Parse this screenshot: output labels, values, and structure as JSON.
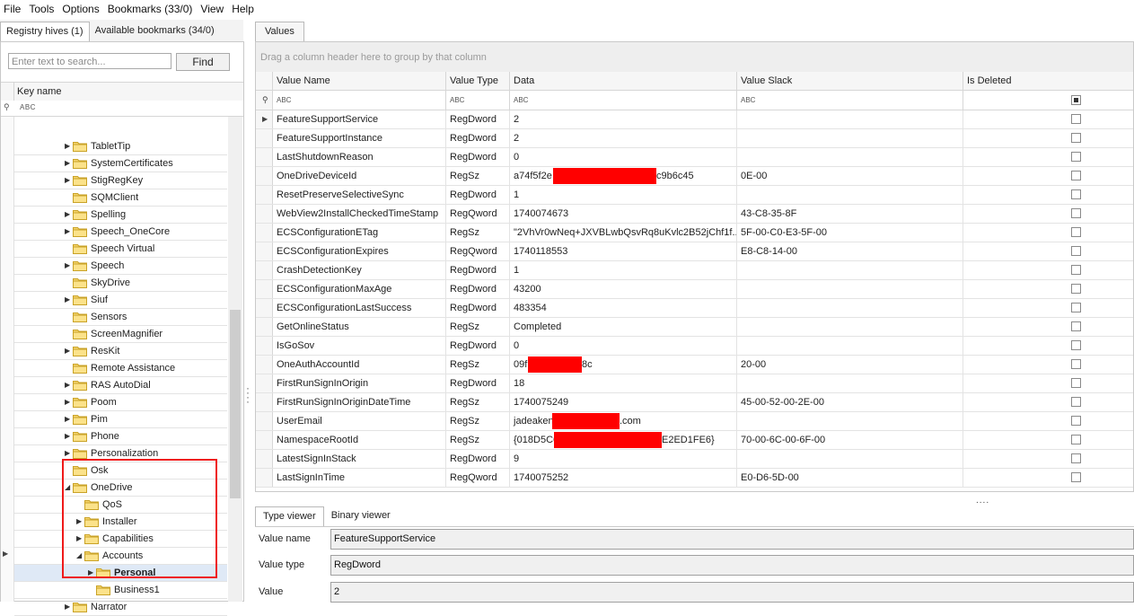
{
  "menu": [
    "File",
    "Tools",
    "Options",
    "Bookmarks (33/0)",
    "View",
    "Help"
  ],
  "left": {
    "tabs": [
      "Registry hives (1)",
      "Available bookmarks (34/0)"
    ],
    "search_placeholder": "Enter text to search...",
    "find_label": "Find",
    "column_header": "Key name",
    "filter_glyph": "ABC",
    "tree": [
      {
        "label": "TabletTip",
        "indent": 0,
        "expandable": true
      },
      {
        "label": "SystemCertificates",
        "indent": 0,
        "expandable": true
      },
      {
        "label": "StigRegKey",
        "indent": 0,
        "expandable": true
      },
      {
        "label": "SQMClient",
        "indent": 0,
        "expandable": false
      },
      {
        "label": "Spelling",
        "indent": 0,
        "expandable": true
      },
      {
        "label": "Speech_OneCore",
        "indent": 0,
        "expandable": true
      },
      {
        "label": "Speech Virtual",
        "indent": 0,
        "expandable": false
      },
      {
        "label": "Speech",
        "indent": 0,
        "expandable": true
      },
      {
        "label": "SkyDrive",
        "indent": 0,
        "expandable": false
      },
      {
        "label": "Siuf",
        "indent": 0,
        "expandable": true
      },
      {
        "label": "Sensors",
        "indent": 0,
        "expandable": false
      },
      {
        "label": "ScreenMagnifier",
        "indent": 0,
        "expandable": false
      },
      {
        "label": "ResKit",
        "indent": 0,
        "expandable": true
      },
      {
        "label": "Remote Assistance",
        "indent": 0,
        "expandable": false
      },
      {
        "label": "RAS AutoDial",
        "indent": 0,
        "expandable": true
      },
      {
        "label": "Poom",
        "indent": 0,
        "expandable": true
      },
      {
        "label": "Pim",
        "indent": 0,
        "expandable": true
      },
      {
        "label": "Phone",
        "indent": 0,
        "expandable": true
      },
      {
        "label": "Personalization",
        "indent": 0,
        "expandable": true
      },
      {
        "label": "Osk",
        "indent": 0,
        "expandable": false
      },
      {
        "label": "OneDrive",
        "indent": 0,
        "expandable": true,
        "expanded": true
      },
      {
        "label": "QoS",
        "indent": 1,
        "expandable": false
      },
      {
        "label": "Installer",
        "indent": 1,
        "expandable": true
      },
      {
        "label": "Capabilities",
        "indent": 1,
        "expandable": true
      },
      {
        "label": "Accounts",
        "indent": 1,
        "expandable": true,
        "expanded": true
      },
      {
        "label": "Personal",
        "indent": 2,
        "expandable": true,
        "selected": true
      },
      {
        "label": "Business1",
        "indent": 2,
        "expandable": false
      },
      {
        "label": "Narrator",
        "indent": 0,
        "expandable": true
      }
    ]
  },
  "values": {
    "tab": "Values",
    "group_hint": "Drag a column header here to group by that column",
    "columns": [
      "Value Name",
      "Value Type",
      "Data",
      "Value Slack",
      "Is Deleted"
    ],
    "rows": [
      {
        "name": "FeatureSupportService",
        "type": "RegDword",
        "data": "2",
        "slack": ""
      },
      {
        "name": "FeatureSupportInstance",
        "type": "RegDword",
        "data": "2",
        "slack": ""
      },
      {
        "name": "LastShutdownReason",
        "type": "RegDword",
        "data": "0",
        "slack": ""
      },
      {
        "name": "OneDriveDeviceId",
        "type": "RegSz",
        "data": "a74f5f2e",
        "data2": "c9b6c45",
        "slack": "0E-00"
      },
      {
        "name": "ResetPreserveSelectiveSync",
        "type": "RegDword",
        "data": "1",
        "slack": ""
      },
      {
        "name": "WebView2InstallCheckedTimeStamp",
        "type": "RegQword",
        "data": "1740074673",
        "slack": "43-C8-35-8F"
      },
      {
        "name": "ECSConfigurationETag",
        "type": "RegSz",
        "data": "\"2VhVr0wNeq+JXVBLwbQsvRq8uKvlc2B52jChf1f...",
        "slack": "5F-00-C0-E3-5F-00"
      },
      {
        "name": "ECSConfigurationExpires",
        "type": "RegQword",
        "data": "1740118553",
        "slack": "E8-C8-14-00"
      },
      {
        "name": "CrashDetectionKey",
        "type": "RegDword",
        "data": "1",
        "slack": ""
      },
      {
        "name": "ECSConfigurationMaxAge",
        "type": "RegDword",
        "data": "43200",
        "slack": ""
      },
      {
        "name": "ECSConfigurationLastSuccess",
        "type": "RegDword",
        "data": "483354",
        "slack": ""
      },
      {
        "name": "GetOnlineStatus",
        "type": "RegSz",
        "data": "Completed",
        "slack": ""
      },
      {
        "name": "IsGoSov",
        "type": "RegDword",
        "data": "0",
        "slack": ""
      },
      {
        "name": "OneAuthAccountId",
        "type": "RegSz",
        "data": "09f",
        "data2": "8c",
        "slack": "20-00"
      },
      {
        "name": "FirstRunSignInOrigin",
        "type": "RegDword",
        "data": "18",
        "slack": ""
      },
      {
        "name": "FirstRunSignInOriginDateTime",
        "type": "RegSz",
        "data": "1740075249",
        "slack": "45-00-52-00-2E-00"
      },
      {
        "name": "UserEmail",
        "type": "RegSz",
        "data": "jadeaken",
        "data2": ".com",
        "slack": ""
      },
      {
        "name": "NamespaceRootId",
        "type": "RegSz",
        "data": "{018D5C6",
        "data2": "E2ED1FE6}",
        "slack": "70-00-6C-00-6F-00"
      },
      {
        "name": "LatestSignInStack",
        "type": "RegDword",
        "data": "9",
        "slack": ""
      },
      {
        "name": "LastSignInTime",
        "type": "RegQword",
        "data": "1740075252",
        "slack": "E0-D6-5D-00"
      }
    ]
  },
  "viewer": {
    "tabs": [
      "Type viewer",
      "Binary viewer"
    ],
    "value_name_label": "Value name",
    "value_name": "FeatureSupportService",
    "value_type_label": "Value type",
    "value_type": "RegDword",
    "value_label": "Value",
    "value": "2"
  }
}
